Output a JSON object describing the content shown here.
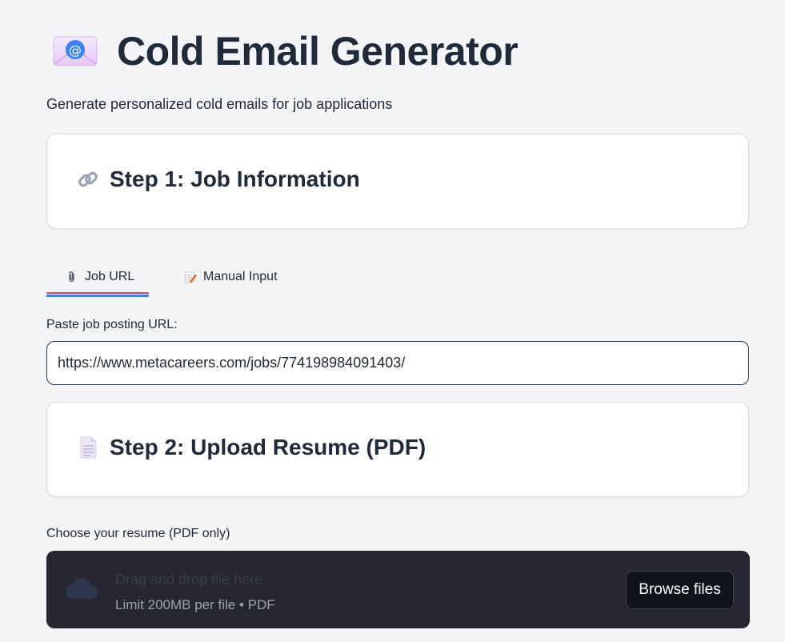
{
  "header": {
    "title": "Cold Email Generator",
    "subtitle": "Generate personalized cold emails for job applications",
    "icon": "email-icon"
  },
  "step1": {
    "heading": "Step 1: Job Information",
    "icon": "link-icon"
  },
  "tabs": [
    {
      "label": "Job URL",
      "icon": "paperclip-icon",
      "active": true
    },
    {
      "label": "Manual Input",
      "icon": "memo-icon",
      "active": false
    }
  ],
  "job_url": {
    "label": "Paste job posting URL:",
    "value": "https://www.metacareers.com/jobs/774198984091403/"
  },
  "step2": {
    "heading": "Step 2: Upload Resume (PDF)",
    "icon": "document-icon"
  },
  "upload": {
    "label": "Choose your resume (PDF only)",
    "drop_text": "Drag and drop file here",
    "limit_text": "Limit 200MB per file • PDF",
    "browse_label": "Browse files"
  },
  "colors": {
    "accent_red": "#ef4444",
    "accent_blue": "#3b82f6",
    "dropzone_bg": "#262730",
    "page_bg": "#f3f4f6"
  }
}
